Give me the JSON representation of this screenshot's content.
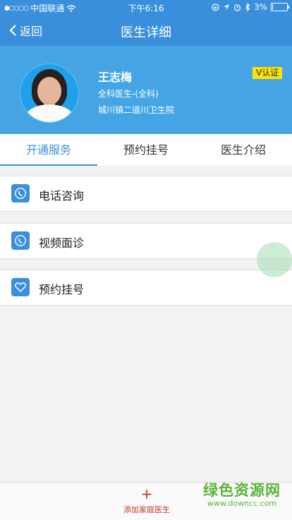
{
  "status_bar": {
    "carrier": "中国联通",
    "time": "下午6:16",
    "battery": "3%",
    "battery_level": 0.03
  },
  "nav": {
    "back_label": "返回",
    "title": "医生详细"
  },
  "doctor": {
    "name": "王志梅",
    "department": "全科医生-(全科)",
    "hospital": "城川镇二道川卫生院",
    "badge": "V认证"
  },
  "tabs": [
    {
      "label": "开通服务",
      "active": true
    },
    {
      "label": "预约挂号",
      "active": false
    },
    {
      "label": "医生介绍",
      "active": false
    }
  ],
  "services": [
    {
      "label": "电话咨询",
      "icon": "phone-icon"
    },
    {
      "label": "视频面诊",
      "icon": "phone-icon"
    },
    {
      "label": "预约挂号",
      "icon": "heart-icon"
    }
  ],
  "bottom": {
    "add_label": "添加家庭医生",
    "plus": "+"
  },
  "watermark": {
    "title": "绿色资源网",
    "url": "www.downcc.com"
  },
  "colors": {
    "primary": "#3a8fdc",
    "header": "#45a5e4",
    "badge": "#ffe200",
    "accent_red": "#c0392b",
    "watermark": "#59b53a"
  }
}
